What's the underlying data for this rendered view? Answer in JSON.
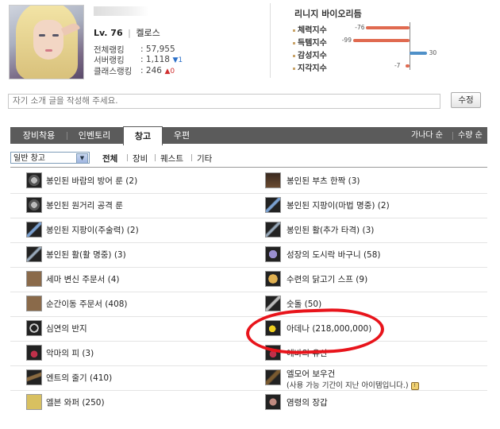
{
  "profile": {
    "level_label": "Lv. 76",
    "server": "켈로스",
    "ranks": [
      {
        "label": "전체랭킹",
        "value": "57,955",
        "change": ""
      },
      {
        "label": "서버랭킹",
        "value": "1,118",
        "change": "▼1"
      },
      {
        "label": "클래스랭킹",
        "value": "246",
        "change": "▲0"
      }
    ]
  },
  "bio": {
    "title": "리니지 바이오리듬",
    "rows": [
      {
        "label": "체력지수",
        "value": -76,
        "value_text": "-76"
      },
      {
        "label": "득템지수",
        "value": -99,
        "value_text": "-99"
      },
      {
        "label": "감성지수",
        "value": 30,
        "value_text": "30"
      },
      {
        "label": "지각지수",
        "value": -7,
        "value_text": "-7"
      }
    ],
    "colors": {
      "negative": "#e06a50",
      "positive": "#4f90c8"
    }
  },
  "intro": {
    "placeholder": "자기 소개 글을 작성해 주세요."
  },
  "edit_button": "수정",
  "tabs": [
    {
      "label": "장비착용",
      "active": false
    },
    {
      "label": "인벤토리",
      "active": false
    },
    {
      "label": "창고",
      "active": true
    },
    {
      "label": "우편",
      "active": false
    }
  ],
  "sort": {
    "name": "가나다 순",
    "qty": "수량 순"
  },
  "filter": {
    "select_value": "일반 창고",
    "links": [
      "전체",
      "장비",
      "퀘스트",
      "기타"
    ]
  },
  "items_left": [
    {
      "name": "봉인된 바람의 방어 룬 (2)",
      "icon": "rune-icon"
    },
    {
      "name": "봉인된 원거리 공격 룬",
      "icon": "rune-icon"
    },
    {
      "name": "봉인된 지팡이(주술력) (2)",
      "icon": "staff-icon"
    },
    {
      "name": "봉인된 활(활 명중) (3)",
      "icon": "bow-icon"
    },
    {
      "name": "세마 변신 주문서 (4)",
      "icon": "scroll-icon"
    },
    {
      "name": "순간이동 주문서 (408)",
      "icon": "scroll-icon"
    },
    {
      "name": "심연의 반지",
      "icon": "ring-icon"
    },
    {
      "name": "악마의 피 (3)",
      "icon": "potion-icon"
    },
    {
      "name": "엔트의 줄기 (410)",
      "icon": "branch-icon"
    },
    {
      "name": "엘븐 와퍼 (250)",
      "icon": "wafer-icon"
    }
  ],
  "items_right": [
    {
      "name": "봉인된 부츠 한짝 (3)",
      "icon": "boot-icon",
      "note": ""
    },
    {
      "name": "봉인된 지팡이(마법 명중) (2)",
      "icon": "staff-icon",
      "note": ""
    },
    {
      "name": "봉인된 활(추가 타격) (3)",
      "icon": "bow-icon",
      "note": ""
    },
    {
      "name": "성장의 도시락 바구니 (58)",
      "icon": "basket-icon",
      "note": ""
    },
    {
      "name": "수련의 닭고기 스프 (9)",
      "icon": "soup-icon",
      "note": ""
    },
    {
      "name": "숫돌 (50)",
      "icon": "whetstone-icon",
      "note": ""
    },
    {
      "name": "아데나 (218,000,000)",
      "icon": "gold-coins-icon",
      "note": ""
    },
    {
      "name": "에바의 유산",
      "icon": "potion-icon",
      "note": ""
    },
    {
      "name": "엘모어 보우건",
      "icon": "crossbow-icon",
      "note": "(사용 가능 기간이 지난 아이템입니다.)"
    },
    {
      "name": "염령의 장갑",
      "icon": "glove-icon",
      "note": ""
    }
  ],
  "annotation_color": "#e8141b"
}
